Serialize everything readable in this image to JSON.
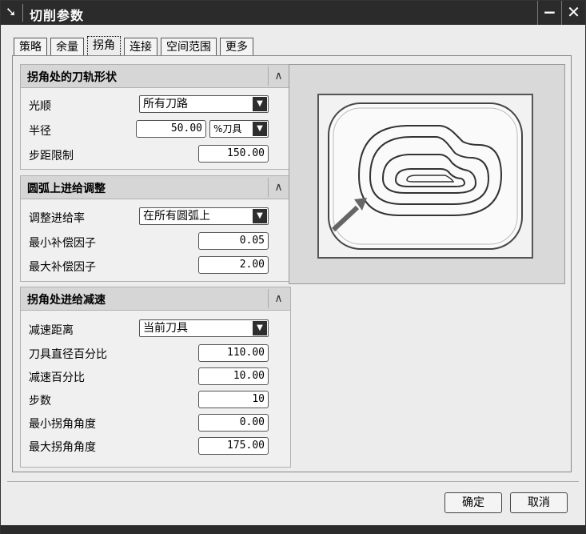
{
  "window": {
    "title": "切削参数",
    "minimize_label": "−",
    "close_label": "✕"
  },
  "tabs": [
    {
      "label": "策略"
    },
    {
      "label": "余量"
    },
    {
      "label": "拐角"
    },
    {
      "label": "连接"
    },
    {
      "label": "空间范围"
    },
    {
      "label": "更多"
    }
  ],
  "sections": {
    "corner_path": {
      "title": "拐角处的刀轨形状",
      "smoothing_label": "光顺",
      "smoothing_value": "所有刀路",
      "radius_label": "半径",
      "radius_value": "50.00",
      "radius_unit": "%刀具",
      "step_limit_label": "步距限制",
      "step_limit_value": "150.00"
    },
    "arc_feed": {
      "title": "圆弧上进给调整",
      "adjust_label": "调整进给率",
      "adjust_value": "在所有圆弧上",
      "min_factor_label": "最小补偿因子",
      "min_factor_value": "0.05",
      "max_factor_label": "最大补偿因子",
      "max_factor_value": "2.00"
    },
    "corner_slowdown": {
      "title": "拐角处进给减速",
      "distance_label": "减速距离",
      "distance_value": "当前刀具",
      "tool_dia_label": "刀具直径百分比",
      "tool_dia_value": "110.00",
      "slow_pct_label": "减速百分比",
      "slow_pct_value": "10.00",
      "steps_label": "步数",
      "steps_value": "10",
      "min_angle_label": "最小拐角角度",
      "min_angle_value": "0.00",
      "max_angle_label": "最大拐角角度",
      "max_angle_value": "175.00"
    }
  },
  "collapse_glyph": "∧",
  "dropdown_glyph": "▼",
  "buttons": {
    "ok": "确定",
    "cancel": "取消"
  },
  "icons": {
    "window_icon": "arrow-cursor-icon",
    "collapse": "chevron-up-icon",
    "dropdown": "chevron-down-icon"
  }
}
